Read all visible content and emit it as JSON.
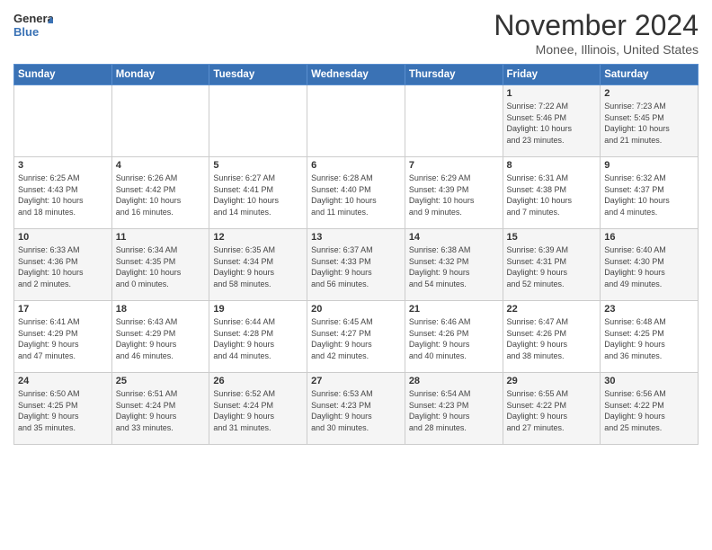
{
  "logo": {
    "line1": "General",
    "line2": "Blue"
  },
  "title": "November 2024",
  "subtitle": "Monee, Illinois, United States",
  "days_of_week": [
    "Sunday",
    "Monday",
    "Tuesday",
    "Wednesday",
    "Thursday",
    "Friday",
    "Saturday"
  ],
  "weeks": [
    [
      {
        "day": "",
        "info": ""
      },
      {
        "day": "",
        "info": ""
      },
      {
        "day": "",
        "info": ""
      },
      {
        "day": "",
        "info": ""
      },
      {
        "day": "",
        "info": ""
      },
      {
        "day": "1",
        "info": "Sunrise: 7:22 AM\nSunset: 5:46 PM\nDaylight: 10 hours\nand 23 minutes."
      },
      {
        "day": "2",
        "info": "Sunrise: 7:23 AM\nSunset: 5:45 PM\nDaylight: 10 hours\nand 21 minutes."
      }
    ],
    [
      {
        "day": "3",
        "info": "Sunrise: 6:25 AM\nSunset: 4:43 PM\nDaylight: 10 hours\nand 18 minutes."
      },
      {
        "day": "4",
        "info": "Sunrise: 6:26 AM\nSunset: 4:42 PM\nDaylight: 10 hours\nand 16 minutes."
      },
      {
        "day": "5",
        "info": "Sunrise: 6:27 AM\nSunset: 4:41 PM\nDaylight: 10 hours\nand 14 minutes."
      },
      {
        "day": "6",
        "info": "Sunrise: 6:28 AM\nSunset: 4:40 PM\nDaylight: 10 hours\nand 11 minutes."
      },
      {
        "day": "7",
        "info": "Sunrise: 6:29 AM\nSunset: 4:39 PM\nDaylight: 10 hours\nand 9 minutes."
      },
      {
        "day": "8",
        "info": "Sunrise: 6:31 AM\nSunset: 4:38 PM\nDaylight: 10 hours\nand 7 minutes."
      },
      {
        "day": "9",
        "info": "Sunrise: 6:32 AM\nSunset: 4:37 PM\nDaylight: 10 hours\nand 4 minutes."
      }
    ],
    [
      {
        "day": "10",
        "info": "Sunrise: 6:33 AM\nSunset: 4:36 PM\nDaylight: 10 hours\nand 2 minutes."
      },
      {
        "day": "11",
        "info": "Sunrise: 6:34 AM\nSunset: 4:35 PM\nDaylight: 10 hours\nand 0 minutes."
      },
      {
        "day": "12",
        "info": "Sunrise: 6:35 AM\nSunset: 4:34 PM\nDaylight: 9 hours\nand 58 minutes."
      },
      {
        "day": "13",
        "info": "Sunrise: 6:37 AM\nSunset: 4:33 PM\nDaylight: 9 hours\nand 56 minutes."
      },
      {
        "day": "14",
        "info": "Sunrise: 6:38 AM\nSunset: 4:32 PM\nDaylight: 9 hours\nand 54 minutes."
      },
      {
        "day": "15",
        "info": "Sunrise: 6:39 AM\nSunset: 4:31 PM\nDaylight: 9 hours\nand 52 minutes."
      },
      {
        "day": "16",
        "info": "Sunrise: 6:40 AM\nSunset: 4:30 PM\nDaylight: 9 hours\nand 49 minutes."
      }
    ],
    [
      {
        "day": "17",
        "info": "Sunrise: 6:41 AM\nSunset: 4:29 PM\nDaylight: 9 hours\nand 47 minutes."
      },
      {
        "day": "18",
        "info": "Sunrise: 6:43 AM\nSunset: 4:29 PM\nDaylight: 9 hours\nand 46 minutes."
      },
      {
        "day": "19",
        "info": "Sunrise: 6:44 AM\nSunset: 4:28 PM\nDaylight: 9 hours\nand 44 minutes."
      },
      {
        "day": "20",
        "info": "Sunrise: 6:45 AM\nSunset: 4:27 PM\nDaylight: 9 hours\nand 42 minutes."
      },
      {
        "day": "21",
        "info": "Sunrise: 6:46 AM\nSunset: 4:26 PM\nDaylight: 9 hours\nand 40 minutes."
      },
      {
        "day": "22",
        "info": "Sunrise: 6:47 AM\nSunset: 4:26 PM\nDaylight: 9 hours\nand 38 minutes."
      },
      {
        "day": "23",
        "info": "Sunrise: 6:48 AM\nSunset: 4:25 PM\nDaylight: 9 hours\nand 36 minutes."
      }
    ],
    [
      {
        "day": "24",
        "info": "Sunrise: 6:50 AM\nSunset: 4:25 PM\nDaylight: 9 hours\nand 35 minutes."
      },
      {
        "day": "25",
        "info": "Sunrise: 6:51 AM\nSunset: 4:24 PM\nDaylight: 9 hours\nand 33 minutes."
      },
      {
        "day": "26",
        "info": "Sunrise: 6:52 AM\nSunset: 4:24 PM\nDaylight: 9 hours\nand 31 minutes."
      },
      {
        "day": "27",
        "info": "Sunrise: 6:53 AM\nSunset: 4:23 PM\nDaylight: 9 hours\nand 30 minutes."
      },
      {
        "day": "28",
        "info": "Sunrise: 6:54 AM\nSunset: 4:23 PM\nDaylight: 9 hours\nand 28 minutes."
      },
      {
        "day": "29",
        "info": "Sunrise: 6:55 AM\nSunset: 4:22 PM\nDaylight: 9 hours\nand 27 minutes."
      },
      {
        "day": "30",
        "info": "Sunrise: 6:56 AM\nSunset: 4:22 PM\nDaylight: 9 hours\nand 25 minutes."
      }
    ]
  ]
}
